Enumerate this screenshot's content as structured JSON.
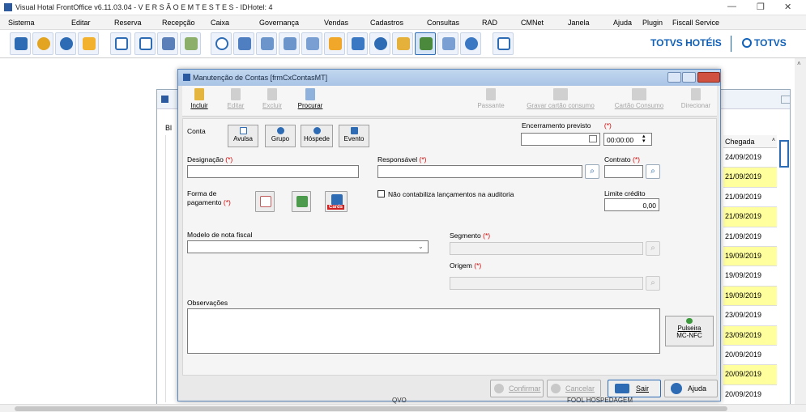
{
  "window": {
    "title": "Visual Hotal FrontOffice v6.11.03.04 - V E R S Ã O  E M  T E S T E S  - IDHotel: 4",
    "minimize": "—",
    "maximize": "❐",
    "close": "✕"
  },
  "menu": [
    "Sistema",
    "Editar",
    "Reserva",
    "Recepção",
    "Caixa",
    "Governança",
    "Vendas",
    "Cadastros",
    "Consultas",
    "RAD",
    "CMNet",
    "Janela",
    "Ajuda",
    "Plugin",
    "Fiscall Service"
  ],
  "brand": {
    "totvs_hoteis": "TOTVS HOTÉIS",
    "totvs": "TOTVS"
  },
  "background_grid": {
    "header": "Chegada",
    "tab_label": "Bl",
    "rows": [
      {
        "date": "24/09/2019",
        "highlight": false
      },
      {
        "date": "21/09/2019",
        "highlight": true
      },
      {
        "date": "21/09/2019",
        "highlight": false
      },
      {
        "date": "21/09/2019",
        "highlight": true
      },
      {
        "date": "21/09/2019",
        "highlight": false
      },
      {
        "date": "19/09/2019",
        "highlight": true
      },
      {
        "date": "19/09/2019",
        "highlight": false
      },
      {
        "date": "19/09/2019",
        "highlight": true
      },
      {
        "date": "23/09/2019",
        "highlight": false
      },
      {
        "date": "23/09/2019",
        "highlight": true
      },
      {
        "date": "20/09/2019",
        "highlight": false
      },
      {
        "date": "20/09/2019",
        "highlight": true
      },
      {
        "date": "20/09/2019",
        "highlight": false
      }
    ],
    "bottom_fragments": {
      "left": "QVO",
      "right": "FOOL HOSPEDAGEM"
    }
  },
  "dialog": {
    "title": "Manutenção de Contas [frmCxContasMT]",
    "toolbar": {
      "incluir": "Incluir",
      "editar": "Editar",
      "excluir": "Excluir",
      "procurar": "Procurar",
      "passante": "Passante",
      "gravar_cartao": "Gravar cartão consumo",
      "cartao_consumo": "Cartão Consumo",
      "direcionar": "Direcionar"
    },
    "form": {
      "conta_label": "Conta",
      "conta_buttons": [
        "Avulsa",
        "Grupo",
        "Hóspede",
        "Evento"
      ],
      "encerramento_label": "Encerramento previsto",
      "encerramento_date": "",
      "encerramento_time": "00:00:00",
      "designacao_label": "Designação",
      "designacao_value": "",
      "responsavel_label": "Responsável",
      "responsavel_value": "",
      "contrato_label": "Contrato",
      "contrato_value": "",
      "forma_pagamento_label_1": "Forma de",
      "forma_pagamento_label_2": "pagamento",
      "cards_label": "Cards",
      "nao_contabiliza": "Não contabiliza lançamentos na auditoria",
      "limite_label": "Limite crédito",
      "limite_value": "0,00",
      "modelo_label": "Modelo de nota fiscal",
      "modelo_value": "",
      "segmento_label": "Segmento",
      "origem_label": "Origem",
      "observacoes_label": "Observações",
      "observacoes_value": "",
      "pulseira_label_1": "Pulseira",
      "pulseira_label_2": "MC-NFC",
      "required_mark": "(*)"
    },
    "buttons": {
      "confirmar": "Confirmar",
      "cancelar": "Cancelar",
      "sair": "Sair",
      "ajuda": "Ajuda"
    }
  }
}
